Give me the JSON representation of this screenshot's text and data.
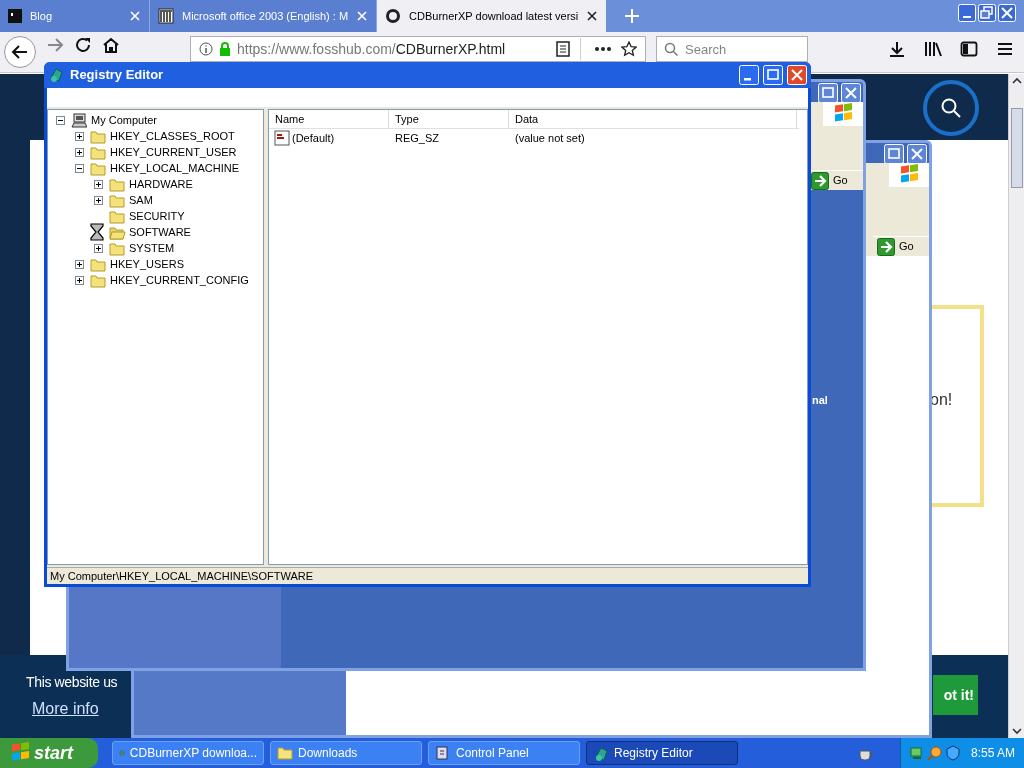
{
  "browser": {
    "tabs": [
      {
        "label": "Blog",
        "selected": false
      },
      {
        "label": "Microsoft office 2003 (English) : M",
        "selected": false
      },
      {
        "label": "CDBurnerXP download latest versi",
        "selected": true
      }
    ],
    "url_host": "https://www.fosshub.com/",
    "url_path": "CDBurnerXP.html",
    "search": {
      "placeholder": "Search"
    }
  },
  "page": {
    "side_text": "on!",
    "cookie_text": "This website us",
    "more_info": "More info",
    "accept_button": "ot it!"
  },
  "back_windows": [
    {
      "go_label": "Go",
      "side_text": "nal"
    },
    {
      "go_label": "Go"
    }
  ],
  "registry_editor": {
    "title": "Registry Editor",
    "tree": [
      {
        "label": "My Computer",
        "kind": "computer",
        "expanded": true,
        "children": [
          {
            "label": "HKEY_CLASSES_ROOT",
            "kind": "folder",
            "expanded": false
          },
          {
            "label": "HKEY_CURRENT_USER",
            "kind": "folder",
            "expanded": false
          },
          {
            "label": "HKEY_LOCAL_MACHINE",
            "kind": "folder",
            "expanded": true,
            "children": [
              {
                "label": "HARDWARE",
                "kind": "folder",
                "expanded": false
              },
              {
                "label": "SAM",
                "kind": "folder",
                "expanded": false
              },
              {
                "label": "SECURITY",
                "kind": "folder"
              },
              {
                "label": "SOFTWARE",
                "kind": "loading-folder"
              },
              {
                "label": "SYSTEM",
                "kind": "folder",
                "expanded": false
              }
            ]
          },
          {
            "label": "HKEY_USERS",
            "kind": "folder",
            "expanded": false
          },
          {
            "label": "HKEY_CURRENT_CONFIG",
            "kind": "folder",
            "expanded": false
          }
        ]
      }
    ],
    "columns": [
      "Name",
      "Type",
      "Data"
    ],
    "rows": [
      {
        "name": "(Default)",
        "type": "REG_SZ",
        "data": "(value not set)"
      }
    ],
    "status": "My Computer\\HKEY_LOCAL_MACHINE\\SOFTWARE"
  },
  "taskbar": {
    "start": "start",
    "items": [
      {
        "label": "CDBurnerXP downloa...",
        "selected": false
      },
      {
        "label": "Downloads",
        "selected": false
      },
      {
        "label": "Control Panel",
        "selected": false
      },
      {
        "label": "Registry Editor",
        "selected": true
      }
    ],
    "clock": "8:55 AM"
  }
}
